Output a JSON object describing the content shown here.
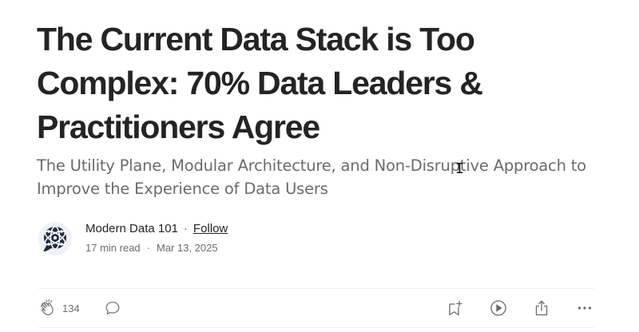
{
  "article": {
    "title": "The Current Data Stack is Too Complex: 70% Data Leaders & Practitioners Agree",
    "subtitle": "The Utility Plane, Modular Architecture, and Non-Disruptive Approach to Improve the Experience of Data Users"
  },
  "author": {
    "name": "Modern Data 101",
    "follow_label": "Follow",
    "read_time": "17 min read",
    "date": "Mar 13, 2025",
    "separator": "·",
    "avatar_icon": "globe-network-logo-icon"
  },
  "actions": {
    "clap_count": "134",
    "clap_icon": "clap-icon",
    "comment_icon": "comment-icon",
    "bookmark_icon": "bookmark-add-icon",
    "listen_icon": "play-icon",
    "share_icon": "share-icon",
    "more_icon": "more-icon"
  },
  "colors": {
    "text_primary": "#242424",
    "text_secondary": "#6b6b6b",
    "divider": "#f0f0f0",
    "avatar_dark": "#1f2a44"
  }
}
